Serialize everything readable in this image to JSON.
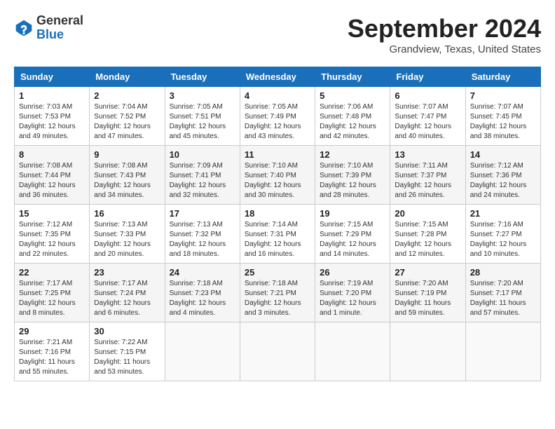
{
  "logo": {
    "general": "General",
    "blue": "Blue"
  },
  "header": {
    "title": "September 2024",
    "location": "Grandview, Texas, United States"
  },
  "days_of_week": [
    "Sunday",
    "Monday",
    "Tuesday",
    "Wednesday",
    "Thursday",
    "Friday",
    "Saturday"
  ],
  "weeks": [
    [
      {
        "day": "1",
        "info": "Sunrise: 7:03 AM\nSunset: 7:53 PM\nDaylight: 12 hours\nand 49 minutes."
      },
      {
        "day": "2",
        "info": "Sunrise: 7:04 AM\nSunset: 7:52 PM\nDaylight: 12 hours\nand 47 minutes."
      },
      {
        "day": "3",
        "info": "Sunrise: 7:05 AM\nSunset: 7:51 PM\nDaylight: 12 hours\nand 45 minutes."
      },
      {
        "day": "4",
        "info": "Sunrise: 7:05 AM\nSunset: 7:49 PM\nDaylight: 12 hours\nand 43 minutes."
      },
      {
        "day": "5",
        "info": "Sunrise: 7:06 AM\nSunset: 7:48 PM\nDaylight: 12 hours\nand 42 minutes."
      },
      {
        "day": "6",
        "info": "Sunrise: 7:07 AM\nSunset: 7:47 PM\nDaylight: 12 hours\nand 40 minutes."
      },
      {
        "day": "7",
        "info": "Sunrise: 7:07 AM\nSunset: 7:45 PM\nDaylight: 12 hours\nand 38 minutes."
      }
    ],
    [
      {
        "day": "8",
        "info": "Sunrise: 7:08 AM\nSunset: 7:44 PM\nDaylight: 12 hours\nand 36 minutes."
      },
      {
        "day": "9",
        "info": "Sunrise: 7:08 AM\nSunset: 7:43 PM\nDaylight: 12 hours\nand 34 minutes."
      },
      {
        "day": "10",
        "info": "Sunrise: 7:09 AM\nSunset: 7:41 PM\nDaylight: 12 hours\nand 32 minutes."
      },
      {
        "day": "11",
        "info": "Sunrise: 7:10 AM\nSunset: 7:40 PM\nDaylight: 12 hours\nand 30 minutes."
      },
      {
        "day": "12",
        "info": "Sunrise: 7:10 AM\nSunset: 7:39 PM\nDaylight: 12 hours\nand 28 minutes."
      },
      {
        "day": "13",
        "info": "Sunrise: 7:11 AM\nSunset: 7:37 PM\nDaylight: 12 hours\nand 26 minutes."
      },
      {
        "day": "14",
        "info": "Sunrise: 7:12 AM\nSunset: 7:36 PM\nDaylight: 12 hours\nand 24 minutes."
      }
    ],
    [
      {
        "day": "15",
        "info": "Sunrise: 7:12 AM\nSunset: 7:35 PM\nDaylight: 12 hours\nand 22 minutes."
      },
      {
        "day": "16",
        "info": "Sunrise: 7:13 AM\nSunset: 7:33 PM\nDaylight: 12 hours\nand 20 minutes."
      },
      {
        "day": "17",
        "info": "Sunrise: 7:13 AM\nSunset: 7:32 PM\nDaylight: 12 hours\nand 18 minutes."
      },
      {
        "day": "18",
        "info": "Sunrise: 7:14 AM\nSunset: 7:31 PM\nDaylight: 12 hours\nand 16 minutes."
      },
      {
        "day": "19",
        "info": "Sunrise: 7:15 AM\nSunset: 7:29 PM\nDaylight: 12 hours\nand 14 minutes."
      },
      {
        "day": "20",
        "info": "Sunrise: 7:15 AM\nSunset: 7:28 PM\nDaylight: 12 hours\nand 12 minutes."
      },
      {
        "day": "21",
        "info": "Sunrise: 7:16 AM\nSunset: 7:27 PM\nDaylight: 12 hours\nand 10 minutes."
      }
    ],
    [
      {
        "day": "22",
        "info": "Sunrise: 7:17 AM\nSunset: 7:25 PM\nDaylight: 12 hours\nand 8 minutes."
      },
      {
        "day": "23",
        "info": "Sunrise: 7:17 AM\nSunset: 7:24 PM\nDaylight: 12 hours\nand 6 minutes."
      },
      {
        "day": "24",
        "info": "Sunrise: 7:18 AM\nSunset: 7:23 PM\nDaylight: 12 hours\nand 4 minutes."
      },
      {
        "day": "25",
        "info": "Sunrise: 7:18 AM\nSunset: 7:21 PM\nDaylight: 12 hours\nand 3 minutes."
      },
      {
        "day": "26",
        "info": "Sunrise: 7:19 AM\nSunset: 7:20 PM\nDaylight: 12 hours\nand 1 minute."
      },
      {
        "day": "27",
        "info": "Sunrise: 7:20 AM\nSunset: 7:19 PM\nDaylight: 11 hours\nand 59 minutes."
      },
      {
        "day": "28",
        "info": "Sunrise: 7:20 AM\nSunset: 7:17 PM\nDaylight: 11 hours\nand 57 minutes."
      }
    ],
    [
      {
        "day": "29",
        "info": "Sunrise: 7:21 AM\nSunset: 7:16 PM\nDaylight: 11 hours\nand 55 minutes."
      },
      {
        "day": "30",
        "info": "Sunrise: 7:22 AM\nSunset: 7:15 PM\nDaylight: 11 hours\nand 53 minutes."
      },
      {
        "day": "",
        "info": ""
      },
      {
        "day": "",
        "info": ""
      },
      {
        "day": "",
        "info": ""
      },
      {
        "day": "",
        "info": ""
      },
      {
        "day": "",
        "info": ""
      }
    ]
  ]
}
